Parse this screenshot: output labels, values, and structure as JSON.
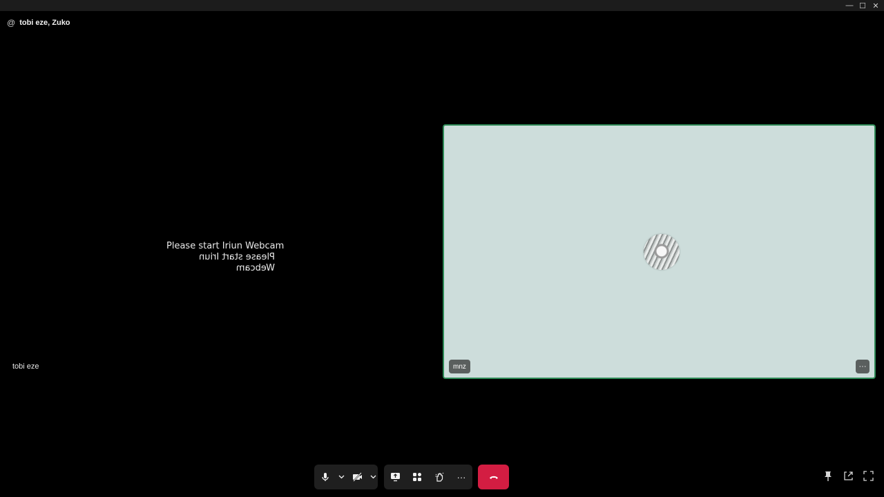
{
  "window": {
    "minimize_glyph": "—",
    "maximize_glyph": "☐",
    "close_glyph": "✕"
  },
  "call": {
    "at_symbol": "@",
    "participants_title": "tobi eze, Zuko"
  },
  "local_video": {
    "message_line": "Please start Iriun Webcam",
    "message_line_mirrored": "Please start Iriun Webcam",
    "participant_name": "tobi eze"
  },
  "remote_tile": {
    "participant_name": "mnz",
    "more_glyph": "···",
    "border_color": "#2e8b57",
    "background_color": "#cddddb"
  },
  "toolbar": {
    "icons": [
      "microphone-icon",
      "chevron-down-icon",
      "camera-off-icon",
      "chevron-down-icon",
      "share-screen-icon",
      "apps-icon",
      "raise-hand-icon",
      "more-icon",
      "hang-up-icon"
    ],
    "end_call_color": "#d31d42",
    "more_glyph": "···"
  },
  "bottom_right": {
    "icons": [
      "pin-icon",
      "popout-icon",
      "fullscreen-icon"
    ]
  }
}
